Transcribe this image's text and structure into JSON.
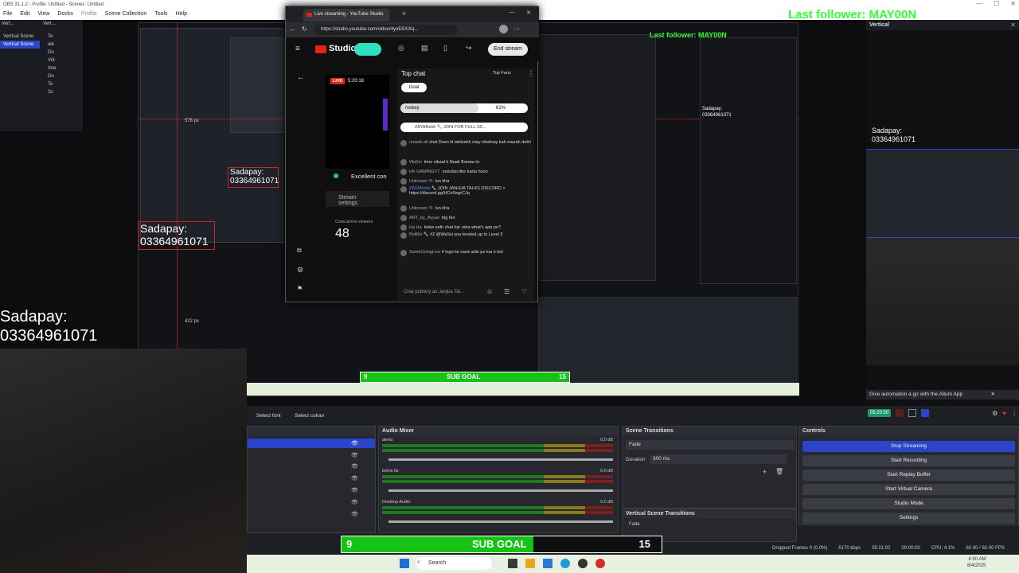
{
  "obs": {
    "title": "OBS 31.1.2 - Profile: Untitled - Scenes: Untitled",
    "menu": [
      "File",
      "Edit",
      "View",
      "Docks",
      "Profile",
      "Scene Collection",
      "Tools",
      "Help"
    ],
    "scenes_tabs": [
      "Vert...",
      "Vert..."
    ],
    "scenes": [
      "Vertical Scene",
      "Vertical Scene"
    ],
    "source_items": [
      "Te",
      "ale",
      "Do",
      "Vid",
      "Ima",
      "Do",
      "Te",
      "Sc"
    ],
    "last_follower": "Last follower: MAY00N",
    "sadapay_label": "Sadapay:",
    "sadapay_number": "03364961071",
    "vertical_title": "Vertical",
    "measure_576": "576 px",
    "measure_422": "422 px",
    "select_font": "Select font",
    "select_colour": "Select colour"
  },
  "youtube": {
    "tab_title": "Live streaming - YouTube Studio",
    "url": "https://studio.youtube.com/video/4yoE6XiXq...",
    "studio_label": "Studio",
    "end_stream": "End stream",
    "live_badge": "LIVE",
    "live_time": "5:20:18",
    "excellent": "Excellent con",
    "stream_settings": "Stream settings",
    "concurrent_label": "Concurrent viewers",
    "concurrent_value": "48",
    "top_chat": "Top chat",
    "top_fans": "Top Fans",
    "goal": "Goal",
    "poll_name": "mokey",
    "poll_pct": "61%",
    "pinned": "ZAYANshk 🔧   JOIN FOR FULL SC...",
    "chat": [
      {
        "name": "musab ali",
        "text": "chal Deen ki tableekh may nikalnay kah mazah dekh"
      },
      {
        "name": "WaSsi",
        "text": "time nikaal k Naak Banwa lo."
      },
      {
        "name": "HK GAMINGYT",
        "text": "unsubscribe karta hoon"
      },
      {
        "name": "Unknown Yt",
        "text": "lun kha"
      },
      {
        "name": "ZAYANshk 🔧",
        "text": "JOIN  JANJUA TALKS  DISCORD > https://discord.gg/HCoSegrCJq"
      },
      {
        "name": "Unknown Yt",
        "text": "lun kha"
      },
      {
        "name": "ART_by_Ayyan",
        "text": "big fan"
      },
      {
        "name": "Ha Ha",
        "text": "kiske sath chat kar raha what's app pe?"
      },
      {
        "name": "BotRix 🔧",
        "text": "#2  @WaSsi you leveled up to Level 3"
      },
      {
        "name": "SarimGoingLive",
        "text": "4 logo ke nack side pe kar k bol"
      }
    ],
    "chat_placeholder": "Chat publicly as Janjua Tal..."
  },
  "audio": {
    "title": "Audio Mixer",
    "tracks": [
      {
        "name": "alerts",
        "db": "0.0 dB"
      },
      {
        "name": "botrix tts",
        "db": "0.0 dB"
      },
      {
        "name": "Desktop Audio",
        "db": "0.0 dB"
      }
    ],
    "ticks": [
      "-60",
      "-55",
      "-50",
      "-45",
      "-40",
      "-35",
      "-30",
      "-25",
      "-20",
      "-15",
      "-10",
      "-5",
      "0"
    ]
  },
  "transitions": {
    "title": "Scene Transitions",
    "type": "Fade",
    "duration_label": "Duration",
    "duration_value": "300 ms",
    "vertical_title": "Vertical Scene Transitions",
    "vertical_type": "Fade"
  },
  "controls": {
    "title": "Controls",
    "buttons": [
      "Stop Streaming",
      "Start Recording",
      "Start Replay Buffer",
      "Start Virtual Camera",
      "Studio Mode",
      "Settings"
    ]
  },
  "vertical_panel": {
    "notice": "Give automation a go with the Aitum App",
    "live_time": "05:20:50"
  },
  "status": {
    "dropped": "Dropped Frames 0 (0.0%)",
    "kbps": "6170 kbps",
    "live_time": "05:21:02",
    "rec_time": "00:00:00",
    "cpu": "CPU: 4.1%",
    "fps": "60.00 / 60.00 FPS"
  },
  "subgoal": {
    "current": "9",
    "label": "SUB GOAL",
    "target": "15",
    "progress": 0.6
  },
  "taskbar": {
    "search": "Search",
    "time": "4:50 AM",
    "date": "8/4/2025"
  },
  "colors": {
    "accent": "#2b45c9",
    "goal_green": "#16c216",
    "follower_green": "#33ff33",
    "live_red": "#e62117"
  }
}
